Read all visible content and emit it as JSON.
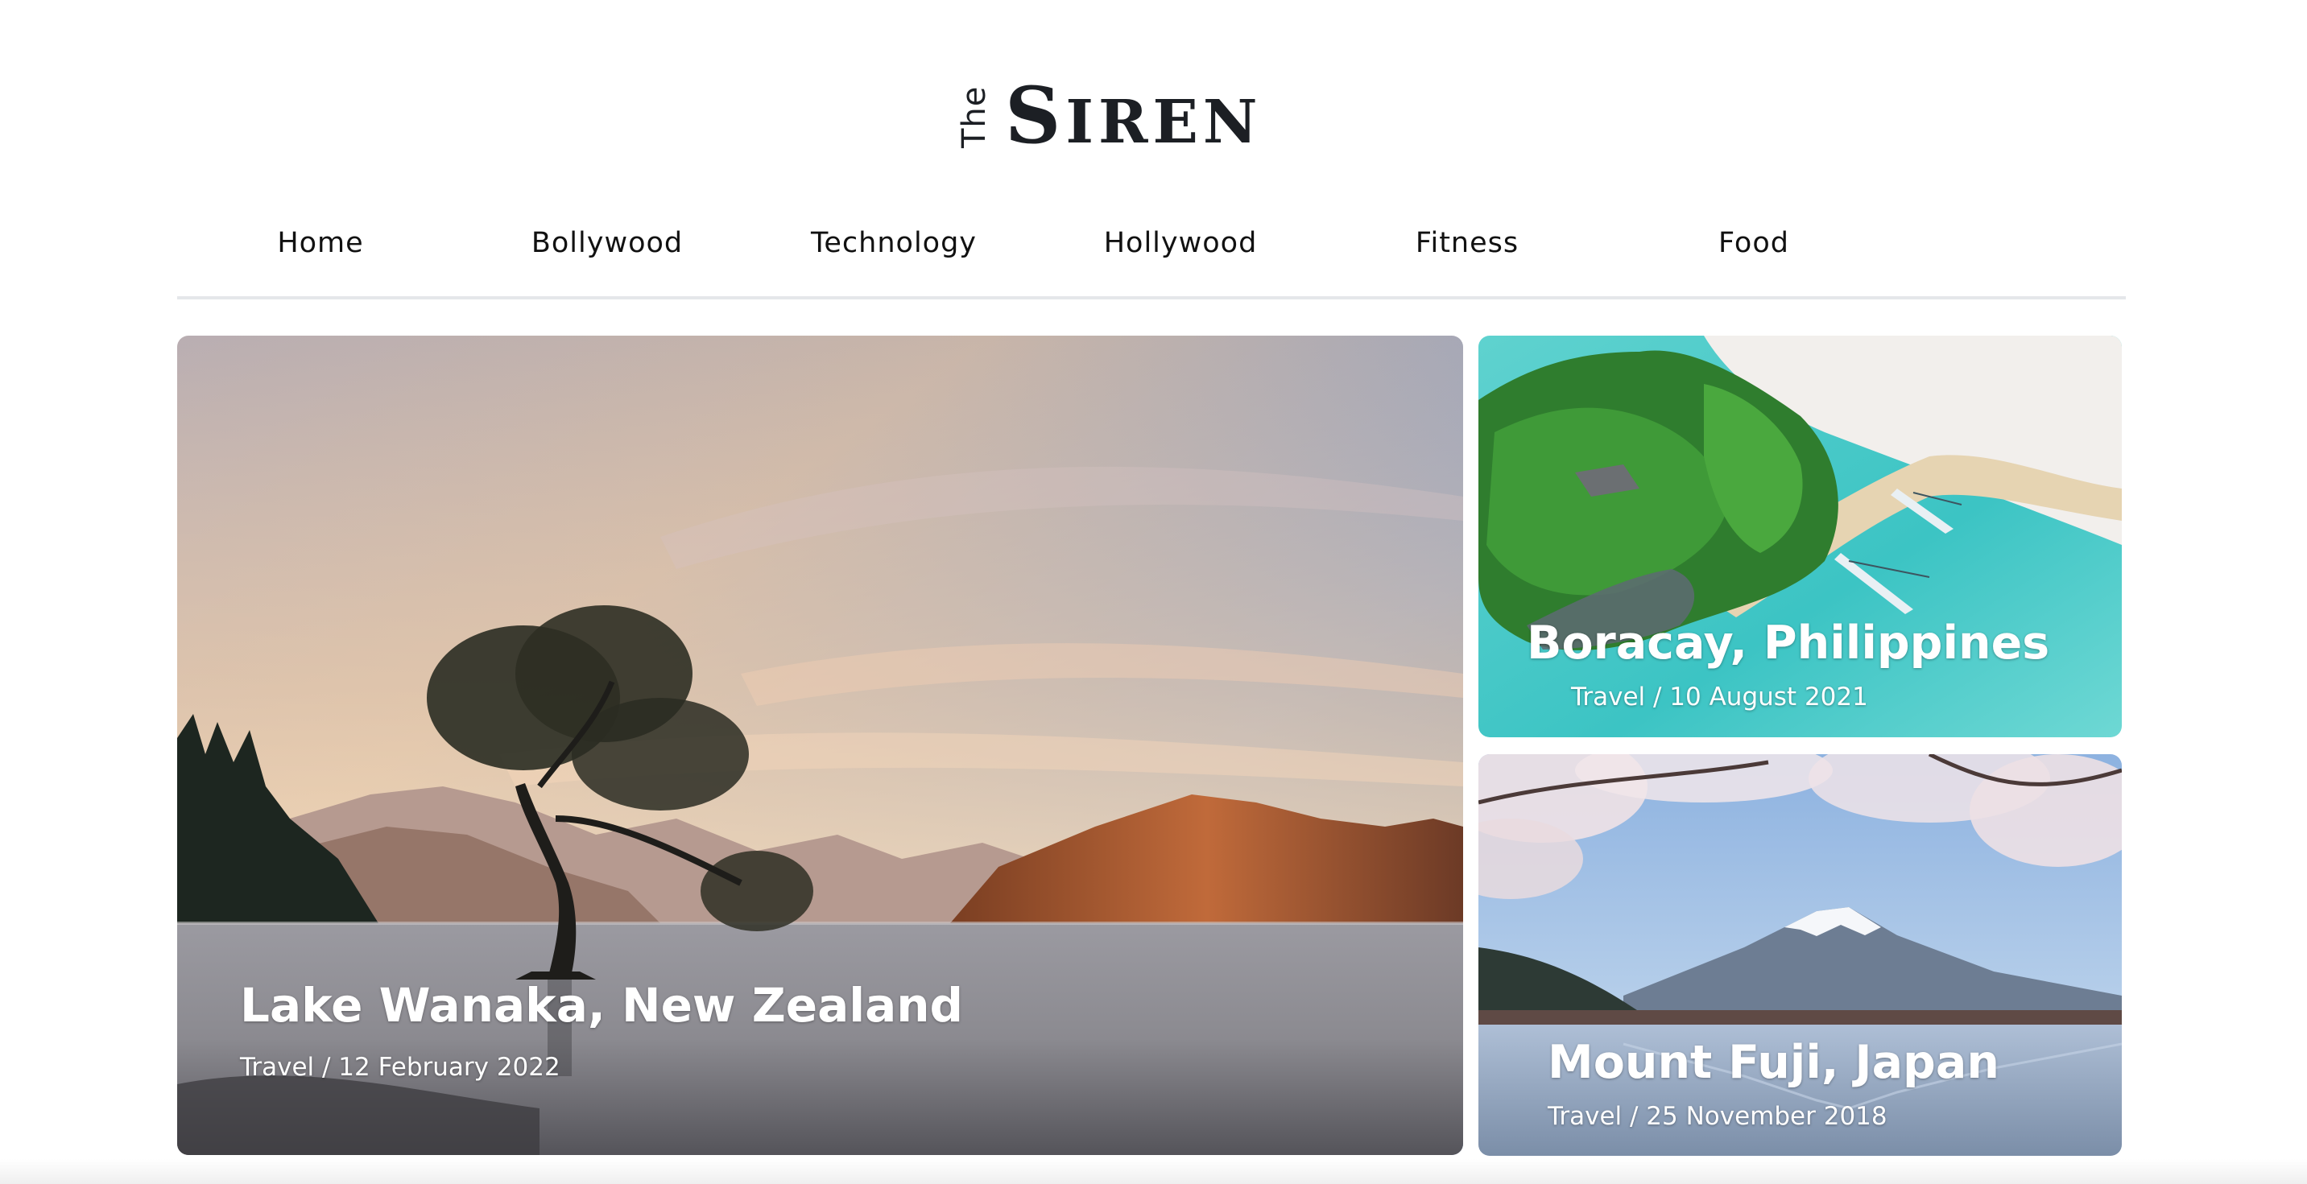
{
  "logo": {
    "the": "The",
    "siren_cap": "S",
    "siren_rest": "IREN"
  },
  "nav": {
    "items": [
      {
        "label": "Home"
      },
      {
        "label": "Bollywood"
      },
      {
        "label": "Technology"
      },
      {
        "label": "Hollywood"
      },
      {
        "label": "Fitness"
      },
      {
        "label": "Food"
      }
    ]
  },
  "cards": {
    "main": {
      "title": "Lake Wanaka, New Zealand",
      "meta": "Travel / 12 February 2022"
    },
    "top_right": {
      "title": "Boracay, Philippines",
      "meta": "Travel / 10 August 2021"
    },
    "bottom_right": {
      "title": "Mount Fuji, Japan",
      "meta": "Travel / 25 November 2018"
    }
  }
}
